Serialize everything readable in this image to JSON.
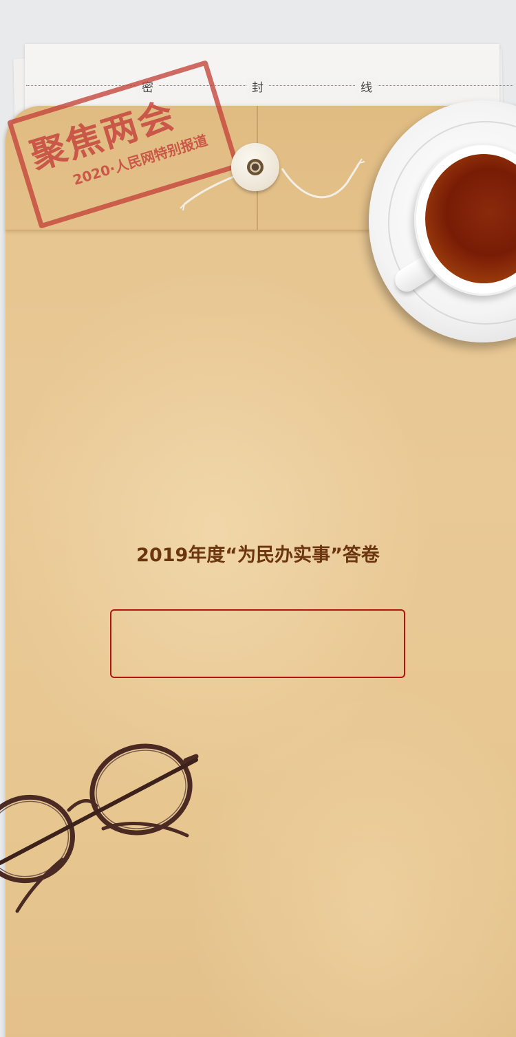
{
  "seal_line": {
    "chars": [
      "密",
      "封",
      "线"
    ]
  },
  "stamp": {
    "title": "聚焦两会",
    "subtitle": "2020·人民网特别报道"
  },
  "main": {
    "title": "2019年度“为民办实事”答卷"
  },
  "colors": {
    "title": "#6b3510",
    "box_border": "#b3120f",
    "envelope": "#e7c690",
    "stamp": "#c4423a"
  }
}
